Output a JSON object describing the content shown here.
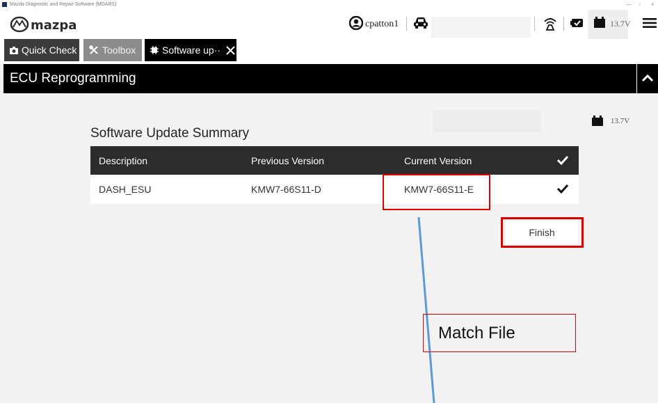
{
  "window": {
    "title": "Mazda Diagnostic and Repair Software (MDARS)",
    "controls": [
      "—",
      "▫",
      "×"
    ]
  },
  "header": {
    "username": "cpatton1",
    "battery_voltage": "13.7V"
  },
  "tabs": [
    {
      "label": "Quick Check"
    },
    {
      "label": "Toolbox"
    },
    {
      "label": "Software up··"
    }
  ],
  "page": {
    "title": "ECU Reprogramming",
    "battery_voltage": "13.7V"
  },
  "summary": {
    "title": "Software Update Summary",
    "columns": [
      "Description",
      "Previous Version",
      "Current Version"
    ],
    "rows": [
      {
        "description": "DASH_ESU",
        "previous": "KMW7-66S11-D",
        "current": "KMW7-66S11-E"
      }
    ],
    "finish_label": "Finish"
  },
  "annotation": {
    "label": "Match File",
    "highlight_color": "#e10000",
    "line_color": "#5b9bd5"
  },
  "colors": {
    "header_band": "#000000",
    "table_header": "#2c2c2c",
    "background": "#f2f2f2"
  }
}
